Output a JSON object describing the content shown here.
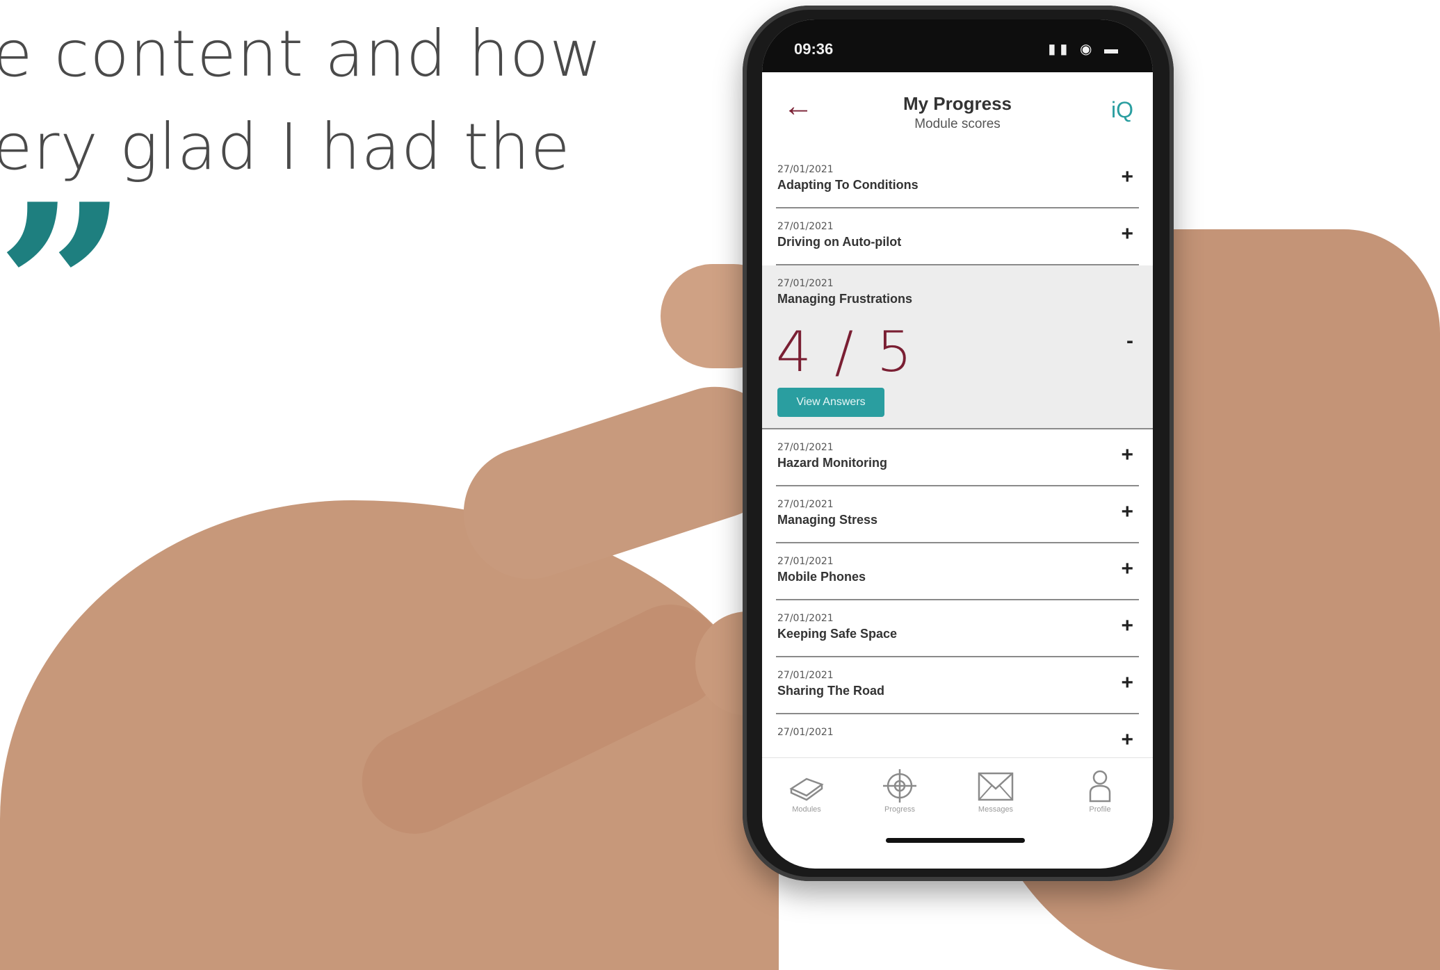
{
  "quote": {
    "lines": [
      "e content and how",
      "ery glad I had the"
    ],
    "mark": "”"
  },
  "phone": {
    "status_bar": {
      "time": "09:36",
      "icons": "▮▮ ◉ ▬"
    },
    "header": {
      "back_icon": "←",
      "title": "My Progress",
      "subtitle": "Module scores",
      "logo": "iQ"
    },
    "modules": [
      {
        "date": "27/01/2021",
        "title": "Adapting To Conditions",
        "toggle": "+"
      },
      {
        "date": "27/01/2021",
        "title": "Driving on Auto-pilot",
        "toggle": "+"
      },
      {
        "date": "27/01/2021",
        "title": "Managing Frustrations",
        "toggle": "-",
        "score": "4 / 5",
        "button": "View Answers"
      },
      {
        "date": "27/01/2021",
        "title": "Hazard Monitoring",
        "toggle": "+"
      },
      {
        "date": "27/01/2021",
        "title": "Managing Stress",
        "toggle": "+"
      },
      {
        "date": "27/01/2021",
        "title": "Mobile Phones",
        "toggle": "+"
      },
      {
        "date": "27/01/2021",
        "title": "Keeping Safe Space",
        "toggle": "+"
      },
      {
        "date": "27/01/2021",
        "title": "Sharing The Road",
        "toggle": "+"
      },
      {
        "date": "27/01/2021",
        "title": "",
        "toggle": "+"
      }
    ],
    "tabs": [
      {
        "label": "Modules",
        "icon": "book-icon"
      },
      {
        "label": "Progress",
        "icon": "crosshair-icon"
      },
      {
        "label": "Messages",
        "icon": "envelope-icon"
      },
      {
        "label": "Profile",
        "icon": "person-icon"
      }
    ]
  },
  "colors": {
    "accent_teal": "#2a9ea0",
    "accent_maroon": "#7a1f33",
    "quote_teal": "#1e7f7f"
  }
}
